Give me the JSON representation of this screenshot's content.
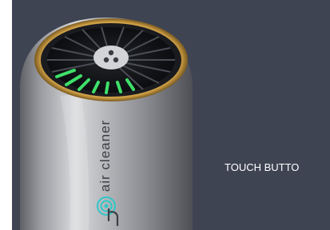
{
  "device": {
    "side_label": "air cleaner",
    "touch_icon": "touch-button-icon",
    "fan_light_color": "#3ee06a",
    "ring_color": "#c99a3a"
  },
  "caption": "TOUCH BUTTO"
}
